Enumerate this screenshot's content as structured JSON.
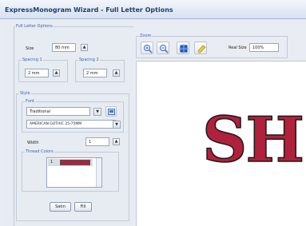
{
  "window": {
    "title": "ExpressMonogram Wizard - Full Letter Options"
  },
  "full_letter": {
    "group_label": "Full Letter Options",
    "size_label": "Size",
    "size_value": "80 mm",
    "spacing1_label": "Spacing 1",
    "spacing1_value": "2 mm",
    "spacing2_label": "Spacing 2",
    "spacing2_value": "2 mm"
  },
  "style": {
    "group_label": "Style",
    "font_label": "Font",
    "font_category": "Traditional",
    "font_name": "AMERICAN GOTHIC 25-75MM",
    "width_label": "Width",
    "width_value": "1",
    "thread_label": "Thread Colors",
    "thread_index": "1",
    "thread_color": "#b0213b",
    "satin_label": "Satin",
    "fill_label": "Fill"
  },
  "zoom": {
    "group_label": "Zoom",
    "real_size_label": "Real Size",
    "real_size_value": "100%",
    "tools": [
      "zoom-in-icon",
      "zoom-out-icon",
      "zoom-fit-icon",
      "pencil-icon"
    ]
  },
  "preview": {
    "text": "SH",
    "fill_color": "#b0213b",
    "outline_color": "#1a1a1a"
  }
}
